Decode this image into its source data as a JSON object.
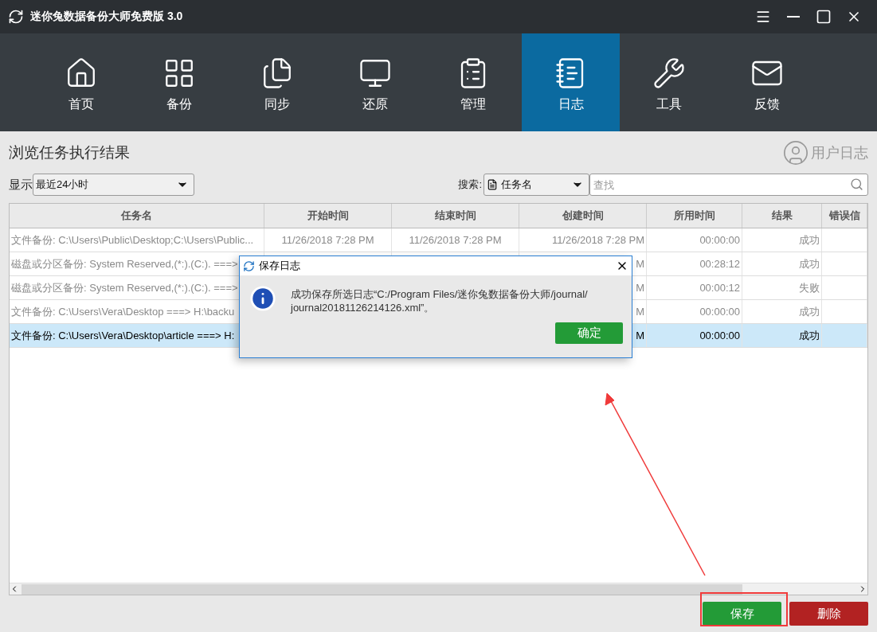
{
  "window": {
    "title": "迷你兔数据备份大师免费版 3.0"
  },
  "nav": [
    {
      "label": "首页",
      "selected": false
    },
    {
      "label": "备份",
      "selected": false
    },
    {
      "label": "同步",
      "selected": false
    },
    {
      "label": "还原",
      "selected": false
    },
    {
      "label": "管理",
      "selected": false
    },
    {
      "label": "日志",
      "selected": true
    },
    {
      "label": "工具",
      "selected": false
    },
    {
      "label": "反馈",
      "selected": false
    }
  ],
  "heading": "浏览任务执行结果",
  "user_log": "用户日志",
  "filter": {
    "label": "显示",
    "value": "最近24小时"
  },
  "search": {
    "label": "搜索:",
    "field": "任务名",
    "placeholder": "查找"
  },
  "table": {
    "columns": [
      "任务名",
      "开始时间",
      "结束时间",
      "创建时间",
      "所用时间",
      "结果",
      "错误信"
    ],
    "rows": [
      {
        "selected": false,
        "cells": [
          "文件备份: C:\\Users\\Public\\Desktop;C:\\Users\\Public...",
          "11/26/2018 7:28 PM",
          "11/26/2018 7:28 PM",
          "11/26/2018 7:28 PM",
          "00:00:00",
          "成功",
          ""
        ]
      },
      {
        "selected": false,
        "cells": [
          "磁盘或分区备份: System Reserved,(*:).(C:). ===>",
          "",
          "",
          "M",
          "00:28:12",
          "成功",
          ""
        ]
      },
      {
        "selected": false,
        "cells": [
          "磁盘或分区备份: System Reserved,(*:).(C:). ===>",
          "",
          "",
          "M",
          "00:00:12",
          "失败",
          ""
        ]
      },
      {
        "selected": false,
        "cells": [
          "文件备份: C:\\Users\\Vera\\Desktop ===> H:\\backu",
          "",
          "",
          "M",
          "00:00:00",
          "成功",
          ""
        ]
      },
      {
        "selected": true,
        "cells": [
          "文件备份: C:\\Users\\Vera\\Desktop\\article ===> H:",
          "",
          "",
          "M",
          "00:00:00",
          "成功",
          ""
        ]
      }
    ]
  },
  "buttons": [
    {
      "label": "保存",
      "kind": "save"
    },
    {
      "label": "删除",
      "kind": "delete"
    }
  ],
  "dialog": {
    "title": "保存日志",
    "message_lines": [
      "成功保存所选日志“C:/Program Files/迷你兔数据备份大师/journal/",
      "journal20181126214126.xml”。"
    ],
    "button": "确定"
  }
}
